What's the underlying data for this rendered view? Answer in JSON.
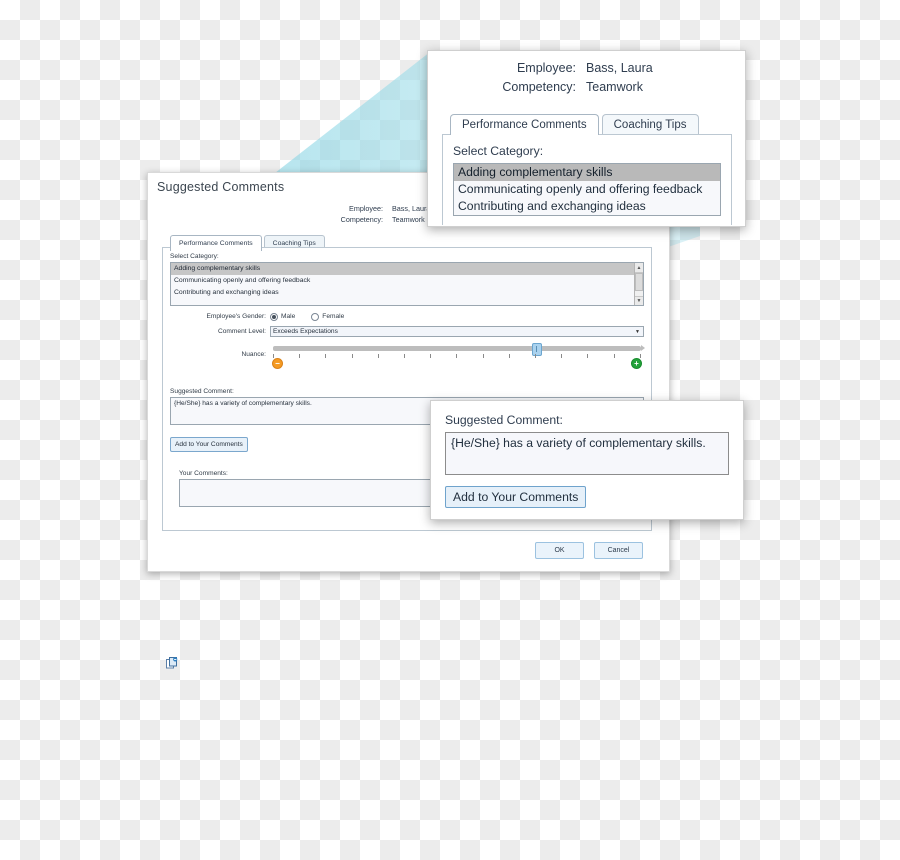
{
  "main_dialog": {
    "title": "Suggested Comments",
    "fields": {
      "employee_label": "Employee:",
      "employee_value": "Bass, Laura",
      "competency_label": "Competency:",
      "competency_value": "Teamwork"
    },
    "tabs": [
      {
        "label": "Performance Comments",
        "active": true
      },
      {
        "label": "Coaching Tips",
        "active": false
      }
    ],
    "select_category_label": "Select Category:",
    "categories": [
      {
        "label": "Adding complementary skills",
        "selected": true
      },
      {
        "label": "Communicating openly and offering feedback",
        "selected": false
      },
      {
        "label": "Contributing and exchanging ideas",
        "selected": false
      }
    ],
    "gender_label": "Employee's Gender:",
    "gender_options": [
      {
        "label": "Male",
        "selected": true
      },
      {
        "label": "Female",
        "selected": false
      }
    ],
    "comment_level_label": "Comment Level:",
    "comment_level_value": "Exceeds Expectations",
    "nuance_label": "Nuance:",
    "nuance_minus_icon": "minus-circle-icon",
    "nuance_plus_icon": "plus-circle-icon",
    "nuance_tick_count": 15,
    "nuance_position_percent": 72,
    "suggested_comment_label": "Suggested Comment:",
    "suggested_comment_value": "{He/She} has a variety of complementary skills.",
    "add_button_label": "Add to Your Comments",
    "your_comments_label": "Your Comments:",
    "your_comments_value": "",
    "paste_icon": "paste-clipboard-icon",
    "ok_label": "OK",
    "cancel_label": "Cancel"
  },
  "callout_top": {
    "fields": {
      "employee_label": "Employee:",
      "employee_value": "Bass, Laura",
      "competency_label": "Competency:",
      "competency_value": "Teamwork"
    },
    "tabs": [
      {
        "label": "Performance Comments",
        "active": true
      },
      {
        "label": "Coaching Tips",
        "active": false
      }
    ],
    "select_category_label": "Select Category:",
    "categories": [
      {
        "label": "Adding complementary skills",
        "selected": true
      },
      {
        "label": "Communicating openly and offering feedback",
        "selected": false
      },
      {
        "label": "Contributing and exchanging ideas",
        "selected": false
      }
    ]
  },
  "callout_bottom": {
    "suggested_comment_label": "Suggested Comment:",
    "suggested_comment_value": "{He/She} has a variety of complementary skills.",
    "add_button_label": "Add to Your Comments"
  },
  "colors": {
    "beam": "#62c6dc",
    "accent_blue": "#7ba7cd",
    "minus_orange": "#f59a22",
    "plus_green": "#22a23a",
    "selection_gray": "#c6c6c6"
  }
}
